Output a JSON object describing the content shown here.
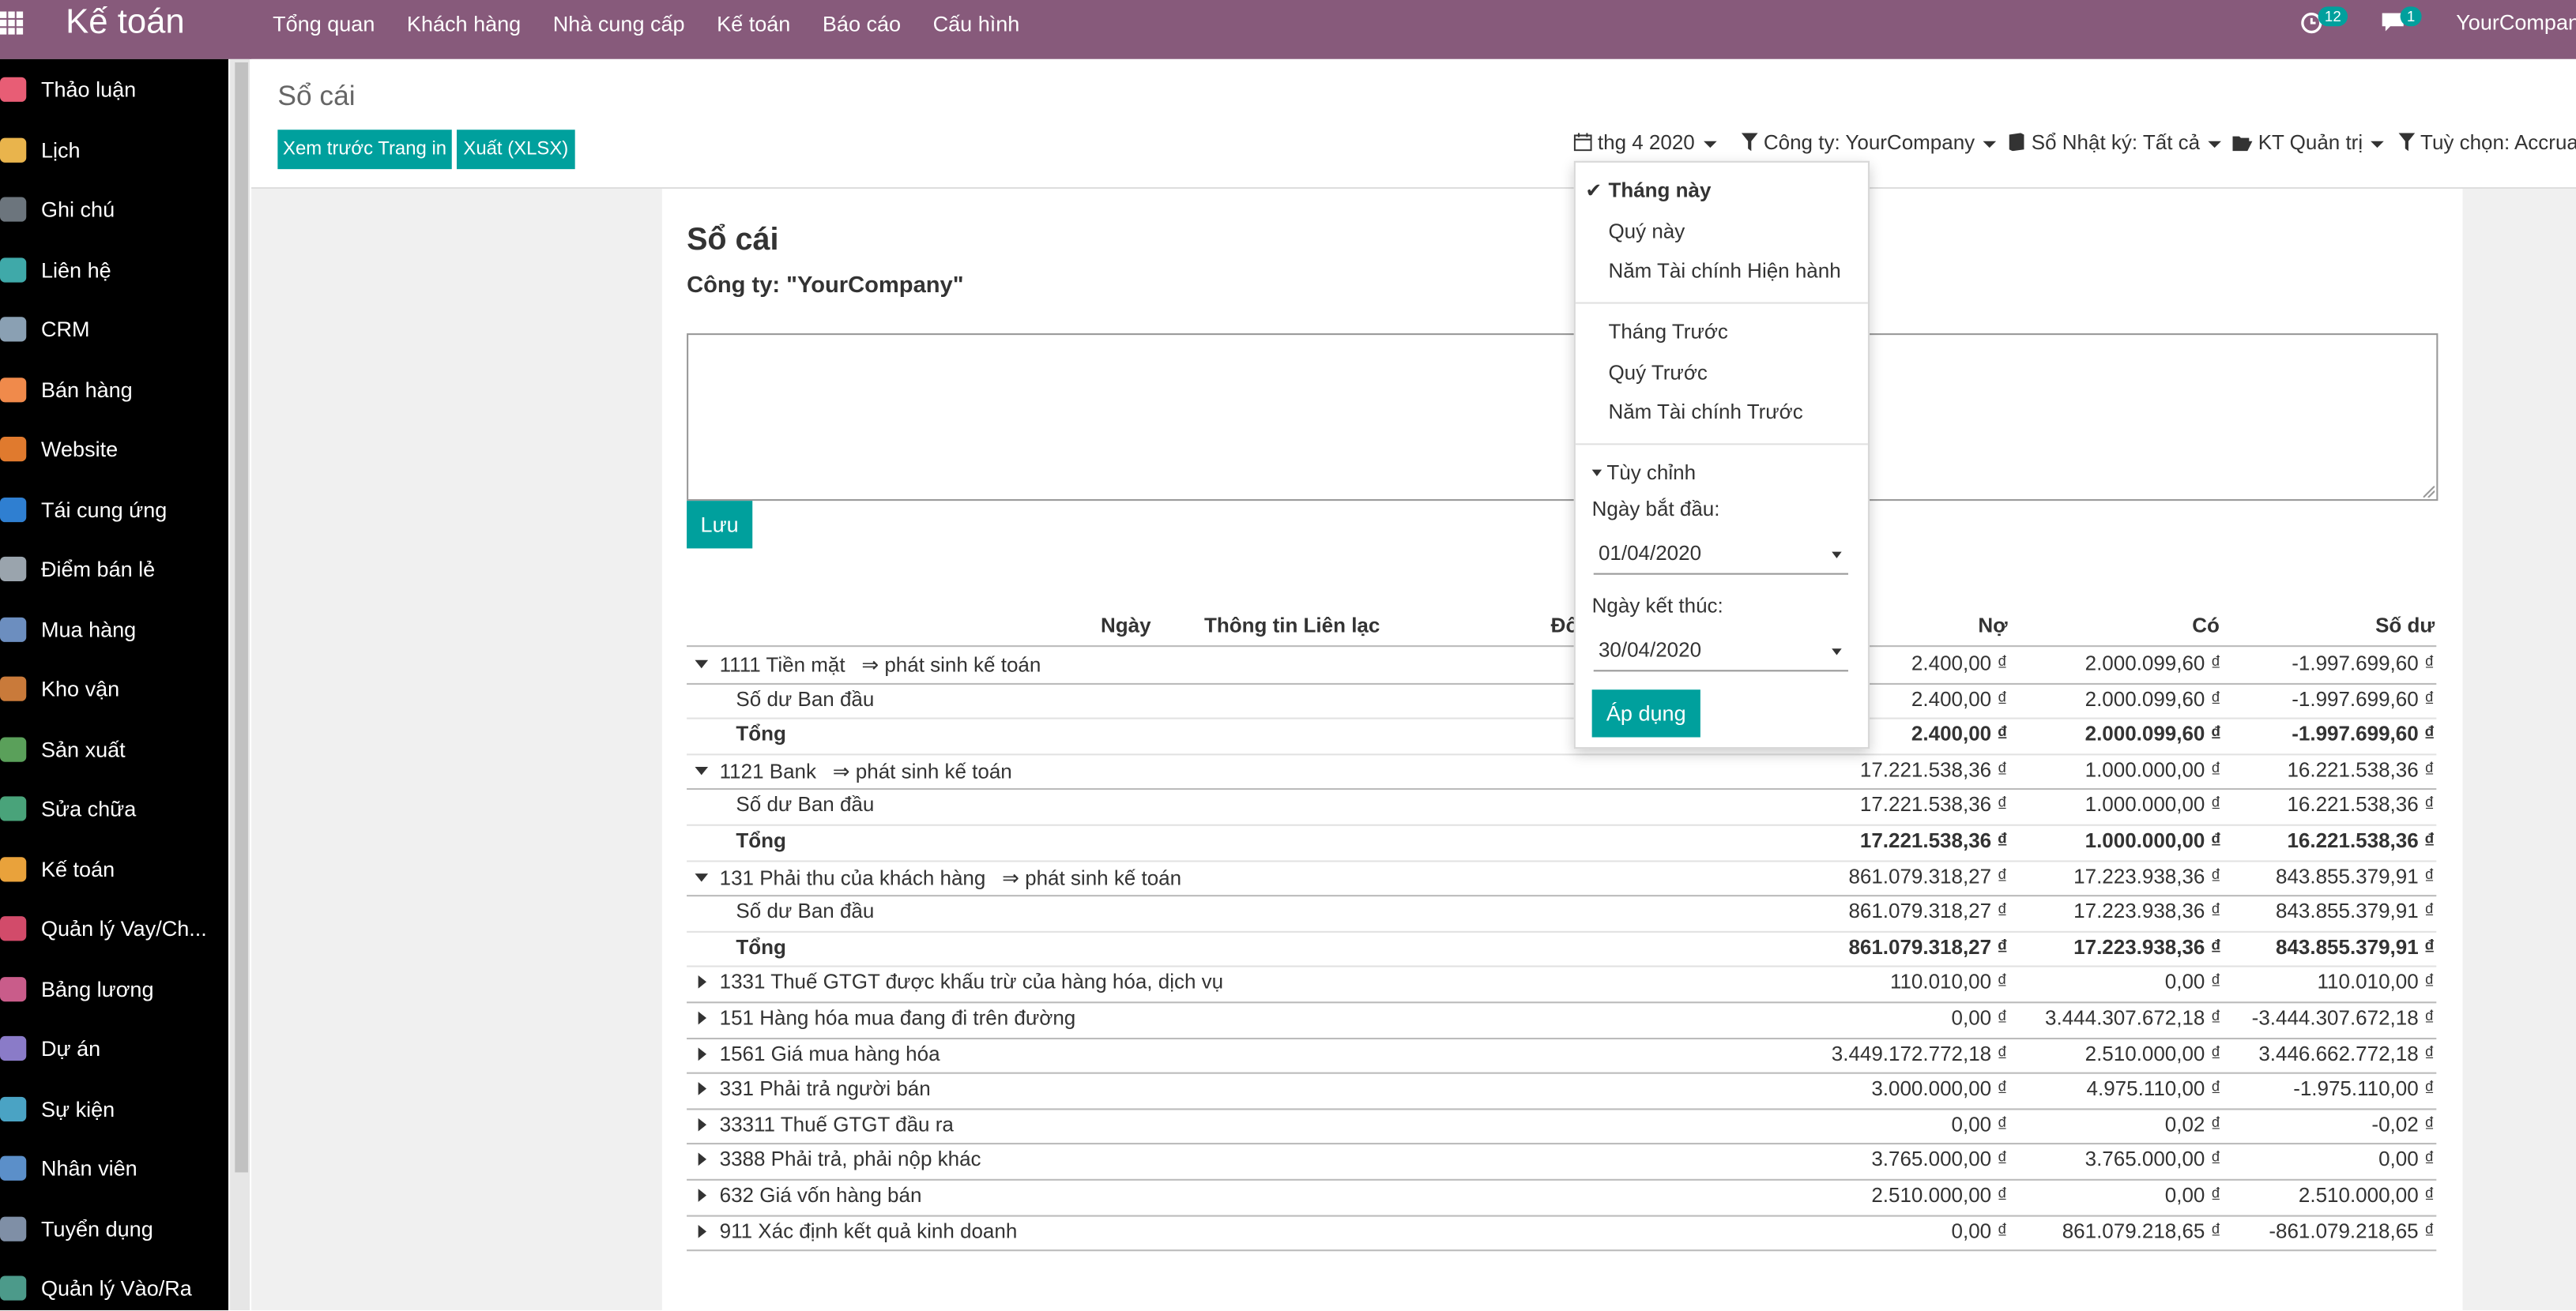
{
  "topbar": {
    "brand": "Kế toán",
    "menu": [
      "Tổng quan",
      "Khách hàng",
      "Nhà cung cấp",
      "Kế toán",
      "Báo cáo",
      "Cấu hình"
    ],
    "activity_count": "12",
    "message_count": "1",
    "company": "YourCompany"
  },
  "sidebar": {
    "items": [
      {
        "label": "Thảo luận",
        "icon": "chat-icon",
        "color": "#e85d75"
      },
      {
        "label": "Lịch",
        "icon": "calendar-icon",
        "color": "#e9b44c"
      },
      {
        "label": "Ghi chú",
        "icon": "note-icon",
        "color": "#6c757d"
      },
      {
        "label": "Liên hệ",
        "icon": "contact-icon",
        "color": "#3fa9a9"
      },
      {
        "label": "CRM",
        "icon": "handshake-icon",
        "color": "#8aa0b3"
      },
      {
        "label": "Bán hàng",
        "icon": "sales-chart-icon",
        "color": "#f08a4b"
      },
      {
        "label": "Website",
        "icon": "globe-icon",
        "color": "#e07a2e"
      },
      {
        "label": "Tái cung ứng",
        "icon": "lifebuoy-icon",
        "color": "#2f7fd1"
      },
      {
        "label": "Điểm bán lẻ",
        "icon": "store-icon",
        "color": "#9aa4ad"
      },
      {
        "label": "Mua hàng",
        "icon": "card-icon",
        "color": "#6c8ebf"
      },
      {
        "label": "Kho vận",
        "icon": "box-icon",
        "color": "#c97a3a"
      },
      {
        "label": "Sản xuất",
        "icon": "wrench-icon",
        "color": "#5aa05a"
      },
      {
        "label": "Sửa chữa",
        "icon": "repair-icon",
        "color": "#49a37a"
      },
      {
        "label": "Kế toán",
        "icon": "accounting-icon",
        "color": "#e9a23b"
      },
      {
        "label": "Quản lý Vay/Ch...",
        "icon": "flask-icon",
        "color": "#d24b6a"
      },
      {
        "label": "Bảng lương",
        "icon": "payroll-icon",
        "color": "#c95c8a"
      },
      {
        "label": "Dự án",
        "icon": "puzzle-icon",
        "color": "#8a7bc8"
      },
      {
        "label": "Sự kiện",
        "icon": "ticket-icon",
        "color": "#4aa3c4"
      },
      {
        "label": "Nhân viên",
        "icon": "people-icon",
        "color": "#5b8fc9"
      },
      {
        "label": "Tuyển dụng",
        "icon": "search-icon",
        "color": "#7f8fa6"
      },
      {
        "label": "Quản lý Vào/Ra",
        "icon": "attendance-icon",
        "color": "#4c9a8a"
      }
    ]
  },
  "control_panel": {
    "title": "Sổ cái",
    "preview_button": "Xem trước Trang in",
    "export_button": "Xuất (XLSX)",
    "filters": {
      "date": "thg 4 2020",
      "company": "Công ty: YourCompany",
      "journal": "Sổ Nhật ký: Tất cả",
      "analytic": "KT Quản trị",
      "options": "Tuỳ chọn: Accrua"
    }
  },
  "report": {
    "title": "Sổ cái",
    "subtitle": "Công ty: \"YourCompany\"",
    "save_button": "Lưu",
    "columns": {
      "date": "Ngày",
      "contact": "Thông tin Liên lạc",
      "partial": "Đố",
      "debit": "Nợ",
      "credit": "Có",
      "balance": "Số dư"
    },
    "rows": [
      {
        "type": "acct",
        "expanded": true,
        "label": "1111 Tiền mặt",
        "link": "⇒ phát sinh kế toán",
        "debit": "2.400,00 ₫",
        "credit": "2.000.099,60 ₫",
        "balance": "-1.997.699,60 ₫"
      },
      {
        "type": "initial",
        "label": "Số dư Ban đầu",
        "debit": "2.400,00 ₫",
        "credit": "2.000.099,60 ₫",
        "balance": "-1.997.699,60 ₫"
      },
      {
        "type": "total",
        "label": "Tổng",
        "debit": "2.400,00 ₫",
        "credit": "2.000.099,60 ₫",
        "balance": "-1.997.699,60 ₫"
      },
      {
        "type": "acct",
        "expanded": true,
        "label": "1121 Bank",
        "link": "⇒ phát sinh kế toán",
        "debit": "17.221.538,36 ₫",
        "credit": "1.000.000,00 ₫",
        "balance": "16.221.538,36 ₫"
      },
      {
        "type": "initial",
        "label": "Số dư Ban đầu",
        "debit": "17.221.538,36 ₫",
        "credit": "1.000.000,00 ₫",
        "balance": "16.221.538,36 ₫"
      },
      {
        "type": "total",
        "label": "Tổng",
        "debit": "17.221.538,36 ₫",
        "credit": "1.000.000,00 ₫",
        "balance": "16.221.538,36 ₫"
      },
      {
        "type": "acct",
        "expanded": true,
        "label": "131 Phải thu của khách hàng",
        "link": "⇒ phát sinh kế toán",
        "debit": "861.079.318,27 ₫",
        "credit": "17.223.938,36 ₫",
        "balance": "843.855.379,91 ₫"
      },
      {
        "type": "initial",
        "label": "Số dư Ban đầu",
        "debit": "861.079.318,27 ₫",
        "credit": "17.223.938,36 ₫",
        "balance": "843.855.379,91 ₫"
      },
      {
        "type": "total",
        "label": "Tổng",
        "debit": "861.079.318,27 ₫",
        "credit": "17.223.938,36 ₫",
        "balance": "843.855.379,91 ₫"
      },
      {
        "type": "acct",
        "expanded": false,
        "label": "1331 Thuế GTGT được khấu trừ của hàng hóa, dịch vụ",
        "link": "",
        "debit": "110.010,00 ₫",
        "credit": "0,00 ₫",
        "balance": "110.010,00 ₫"
      },
      {
        "type": "acct",
        "expanded": false,
        "label": "151 Hàng hóa mua đang đi trên đường",
        "link": "",
        "debit": "0,00 ₫",
        "credit": "3.444.307.672,18 ₫",
        "balance": "-3.444.307.672,18 ₫"
      },
      {
        "type": "acct",
        "expanded": false,
        "label": "1561 Giá mua hàng hóa",
        "link": "",
        "debit": "3.449.172.772,18 ₫",
        "credit": "2.510.000,00 ₫",
        "balance": "3.446.662.772,18 ₫"
      },
      {
        "type": "acct",
        "expanded": false,
        "label": "331 Phải trả người bán",
        "link": "",
        "debit": "3.000.000,00 ₫",
        "credit": "4.975.110,00 ₫",
        "balance": "-1.975.110,00 ₫"
      },
      {
        "type": "acct",
        "expanded": false,
        "label": "33311 Thuế GTGT đầu ra",
        "link": "",
        "debit": "0,00 ₫",
        "credit": "0,02 ₫",
        "balance": "-0,02 ₫"
      },
      {
        "type": "acct",
        "expanded": false,
        "label": "3388 Phải trả, phải nộp khác",
        "link": "",
        "debit": "3.765.000,00 ₫",
        "credit": "3.765.000,00 ₫",
        "balance": "0,00 ₫"
      },
      {
        "type": "acct",
        "expanded": false,
        "label": "632 Giá vốn hàng bán",
        "link": "",
        "debit": "2.510.000,00 ₫",
        "credit": "0,00 ₫",
        "balance": "2.510.000,00 ₫"
      },
      {
        "type": "acct",
        "expanded": false,
        "label": "911 Xác định kết quả kinh doanh",
        "link": "",
        "debit": "0,00 ₫",
        "credit": "861.079.218,65 ₫",
        "balance": "-861.079.218,65 ₫"
      }
    ]
  },
  "date_dropdown": {
    "this_month": "Tháng này",
    "this_quarter": "Quý này",
    "this_fiscal_year": "Năm Tài chính Hiện hành",
    "last_month": "Tháng Trước",
    "last_quarter": "Quý Trước",
    "last_fiscal_year": "Năm Tài chính Trước",
    "custom": "Tùy chỉnh",
    "start_label": "Ngày bắt đầu:",
    "start_value": "01/04/2020",
    "end_label": "Ngày kết thúc:",
    "end_value": "30/04/2020",
    "apply": "Áp dụng"
  }
}
